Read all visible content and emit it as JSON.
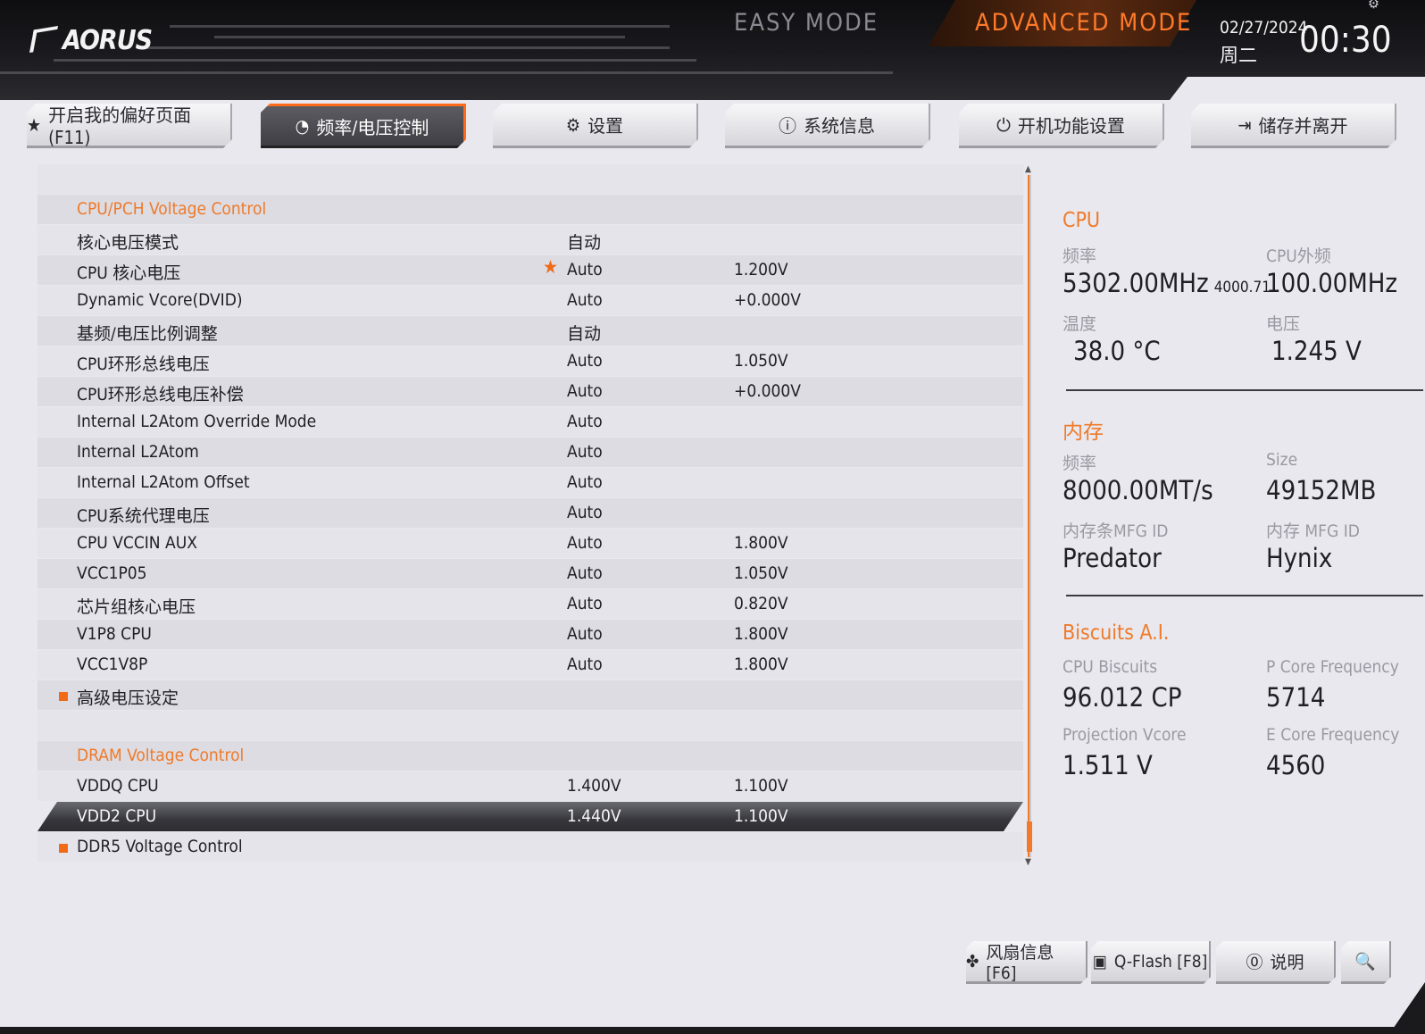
{
  "header": {
    "logo": "AORUS",
    "easy_mode": "EASY MODE",
    "advanced_mode": "ADVANCED MODE",
    "date": "02/27/2024",
    "weekday": "周二",
    "time": "00:30"
  },
  "tabs": [
    {
      "icon": "favorites-icon",
      "glyph": "★",
      "label": "开启我的偏好页面 (F11)"
    },
    {
      "icon": "speedometer-icon",
      "glyph": "◔",
      "label": "频率/电压控制"
    },
    {
      "icon": "gear-icon",
      "glyph": "⚙",
      "label": "设置"
    },
    {
      "icon": "info-icon",
      "glyph": "ⓘ",
      "label": "系统信息"
    },
    {
      "icon": "power-icon",
      "glyph": "⏻",
      "label": "开机功能设置"
    },
    {
      "icon": "exit-icon",
      "glyph": "⇥",
      "label": "储存并离开"
    }
  ],
  "rows": [
    {
      "type": "blank"
    },
    {
      "type": "section",
      "label": "CPU/PCH Voltage Control"
    },
    {
      "label": "核心电压模式",
      "v1": "自动",
      "v2": ""
    },
    {
      "label": "CPU 核心电压",
      "v1": "Auto",
      "v2": "1.200V",
      "star": true
    },
    {
      "label": "Dynamic Vcore(DVID)",
      "v1": "Auto",
      "v2": "+0.000V"
    },
    {
      "label": "基频/电压比例调整",
      "v1": "自动",
      "v2": ""
    },
    {
      "label": "CPU环形总线电压",
      "v1": "Auto",
      "v2": "1.050V"
    },
    {
      "label": "CPU环形总线电压补偿",
      "v1": "Auto",
      "v2": "+0.000V"
    },
    {
      "label": "Internal L2Atom Override Mode",
      "v1": "Auto",
      "v2": ""
    },
    {
      "label": "Internal L2Atom",
      "v1": "Auto",
      "v2": ""
    },
    {
      "label": "Internal L2Atom Offset",
      "v1": "Auto",
      "v2": ""
    },
    {
      "label": "CPU系统代理电压",
      "v1": "Auto",
      "v2": ""
    },
    {
      "label": "CPU VCCIN AUX",
      "v1": "Auto",
      "v2": "1.800V"
    },
    {
      "label": "VCC1P05",
      "v1": "Auto",
      "v2": "1.050V"
    },
    {
      "label": "芯片组核心电压",
      "v1": "Auto",
      "v2": "0.820V"
    },
    {
      "label": "V1P8 CPU",
      "v1": "Auto",
      "v2": "1.800V"
    },
    {
      "label": "VCC1V8P",
      "v1": "Auto",
      "v2": "1.800V"
    },
    {
      "type": "submenu",
      "label": "高级电压设定"
    },
    {
      "type": "blank"
    },
    {
      "type": "section",
      "label": "DRAM Voltage Control"
    },
    {
      "label": "VDDQ CPU",
      "v1": "1.400V",
      "v2": "1.100V"
    },
    {
      "label": "VDD2 CPU",
      "v1": "1.440V",
      "v2": "1.100V",
      "selected": true
    },
    {
      "type": "submenu",
      "label": "DDR5 Voltage Control"
    }
  ],
  "info": {
    "cpu": {
      "title": "CPU",
      "freq_label": "频率",
      "freq_value": "5302.00MHz",
      "freq_sub": "4000.71",
      "bclk_label": "CPU外频",
      "bclk_value": "100.00MHz",
      "temp_label": "温度",
      "temp_value": "38.0 °C",
      "volt_label": "电压",
      "volt_value": "1.245 V"
    },
    "memory": {
      "title": "内存",
      "freq_label": "频率",
      "freq_value": "8000.00MT/s",
      "size_label": "Size",
      "size_value": "49152MB",
      "module_label": "内存条MFG ID",
      "module_value": "Predator",
      "mfg_label": "内存 MFG ID",
      "mfg_value": "Hynix"
    },
    "biscuits": {
      "title": "Biscuits A.I.",
      "cpu_label": "CPU Biscuits",
      "cpu_value": "96.012 CP",
      "pcore_label": "P Core Frequency",
      "pcore_value": "5714",
      "vcore_label": "Projection Vcore",
      "vcore_value": "1.511 V",
      "ecore_label": "E Core Frequency",
      "ecore_value": "4560"
    }
  },
  "bottom_buttons": [
    {
      "icon": "fan-icon",
      "glyph": "✤",
      "label": "风扇信息 [F6]"
    },
    {
      "icon": "chip-icon",
      "glyph": "▣",
      "label": "Q-Flash [F8]"
    },
    {
      "icon": "help-icon",
      "glyph": "⓪",
      "label": "说明"
    },
    {
      "icon": "search-icon",
      "glyph": "🔍",
      "label": ""
    }
  ],
  "colors": {
    "accent": "#ef7a2a",
    "background": "#e9e8ee",
    "header": "#1b1b1f"
  }
}
